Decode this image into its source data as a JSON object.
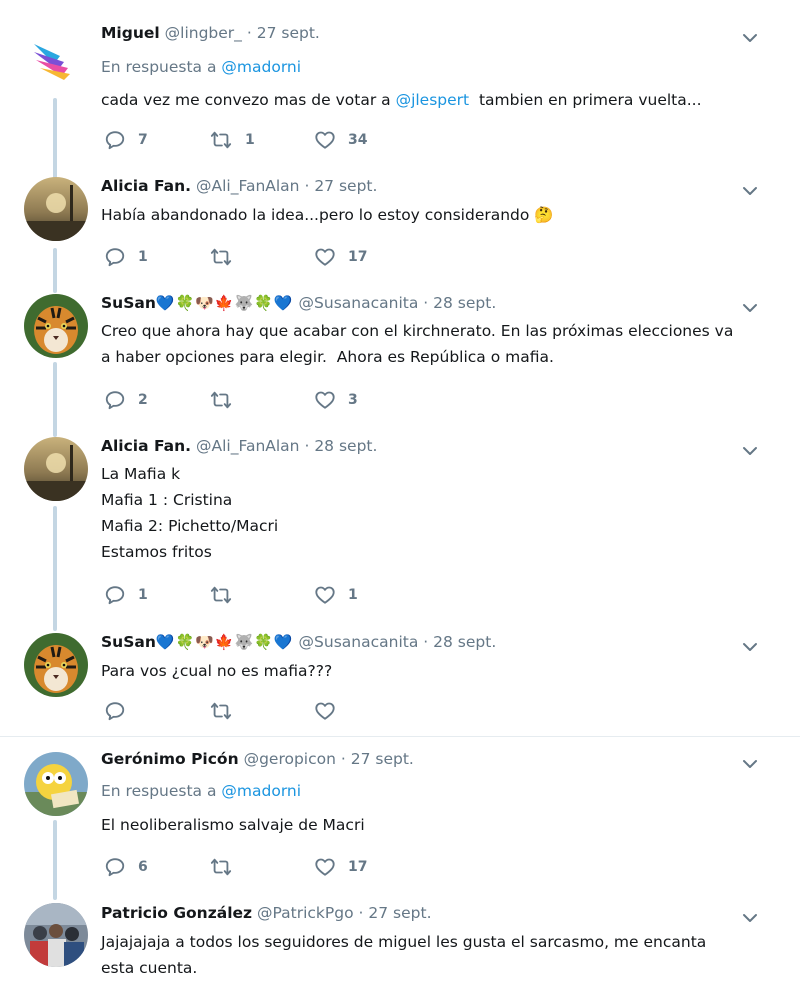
{
  "reply_prefix": "En respuesta a",
  "tweets": [
    {
      "name": "Miguel",
      "handle": "@lingber_",
      "time": "27 sept.",
      "reply_to": "@madorni",
      "text_parts": [
        "cada vez me convezo mas de votar a ",
        "@jlespert",
        "  tambien en primera vuelta..."
      ],
      "replies": "7",
      "retweets": "1",
      "likes": "34"
    },
    {
      "name": "Alicia Fan.",
      "handle": "@Ali_FanAlan",
      "time": "27 sept.",
      "text": "Había abandonado la idea...pero lo estoy considerando 🤔",
      "replies": "1",
      "retweets": "",
      "likes": "17"
    },
    {
      "name": "SuSan",
      "name_emojis": "💙🍀🐶🍁🐺🍀💙",
      "handle": "@Susanacanita",
      "time": "28 sept.",
      "lines": [
        "Creo que ahora hay que acabar con el kirchnerato. En las próximas elecciones va",
        "a haber opciones para elegir.  Ahora es República o mafia."
      ],
      "replies": "2",
      "retweets": "",
      "likes": "3"
    },
    {
      "name": "Alicia Fan.",
      "handle": "@Ali_FanAlan",
      "time": "28 sept.",
      "lines": [
        "La Mafia k",
        "Mafia 1 : Cristina",
        "Mafia 2: Pichetto/Macri",
        "Estamos fritos"
      ],
      "replies": "1",
      "retweets": "",
      "likes": "1"
    },
    {
      "name": "SuSan",
      "name_emojis": "💙🍀🐶🍁🐺🍀💙",
      "handle": "@Susanacanita",
      "time": "28 sept.",
      "text": "Para vos ¿cual no es mafia???",
      "replies": "",
      "retweets": "",
      "likes": ""
    },
    {
      "name": "Gerónimo Picón",
      "handle": "@geropicon",
      "time": "27 sept.",
      "reply_to": "@madorni",
      "text": "El neoliberalismo salvaje de Macri",
      "replies": "6",
      "retweets": "",
      "likes": "17"
    },
    {
      "name": "Patricio González",
      "handle": "@PatrickPgo",
      "time": "27 sept.",
      "lines": [
        "Jajajajaja a todos los seguidores de miguel les gusta el sarcasmo, me encanta",
        "esta cuenta."
      ]
    }
  ]
}
